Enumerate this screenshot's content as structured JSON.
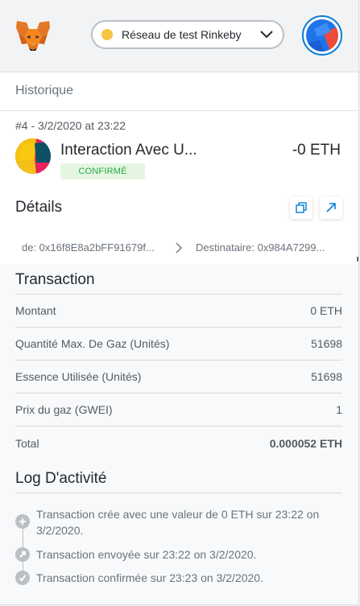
{
  "header": {
    "network_label": "Réseau de test Rinkeby",
    "network_color": "#f6c343",
    "logo_icon": "metamask-fox-icon",
    "account_icon": "account-identicon"
  },
  "history": {
    "title": "Historique",
    "transaction": {
      "meta": "#4 - 3/2/2020 at 23:22",
      "title": "Interaction Avec U...",
      "status": "CONFIRMÉ",
      "amount": "-0 ETH"
    }
  },
  "details": {
    "title": "Détails",
    "from": "de: 0x16f8E8a2bFF91679f...",
    "to": "Destinataire: 0x984A7299..."
  },
  "transaction_section": {
    "title": "Transaction",
    "rows": [
      {
        "label": "Montant",
        "value": "0 ETH"
      },
      {
        "label": "Quantité Max. De Gaz (Unités)",
        "value": "51698"
      },
      {
        "label": "Essence Utilisée (Unités)",
        "value": "51698"
      },
      {
        "label": "Prix du gaz (GWEI)",
        "value": "1"
      },
      {
        "label": "Total",
        "value": "0.000052 ETH"
      }
    ]
  },
  "activity": {
    "title": "Log D'activité",
    "events": [
      {
        "text": "Transaction crée avec une valeur de 0 ETH sur 23:22 on 3/2/2020.",
        "icon": "plus-icon"
      },
      {
        "text": "Transaction envoyée sur 23:22 on 3/2/2020.",
        "icon": "arrow-up-right-icon"
      },
      {
        "text": "Transaction confirmée sur 23:23 on 3/2/2020.",
        "icon": "checkmark-icon"
      }
    ]
  },
  "colors": {
    "accent_blue": "#037dd6",
    "confirmed_green": "#28a745",
    "confirmed_bg": "#e4f6e1"
  }
}
